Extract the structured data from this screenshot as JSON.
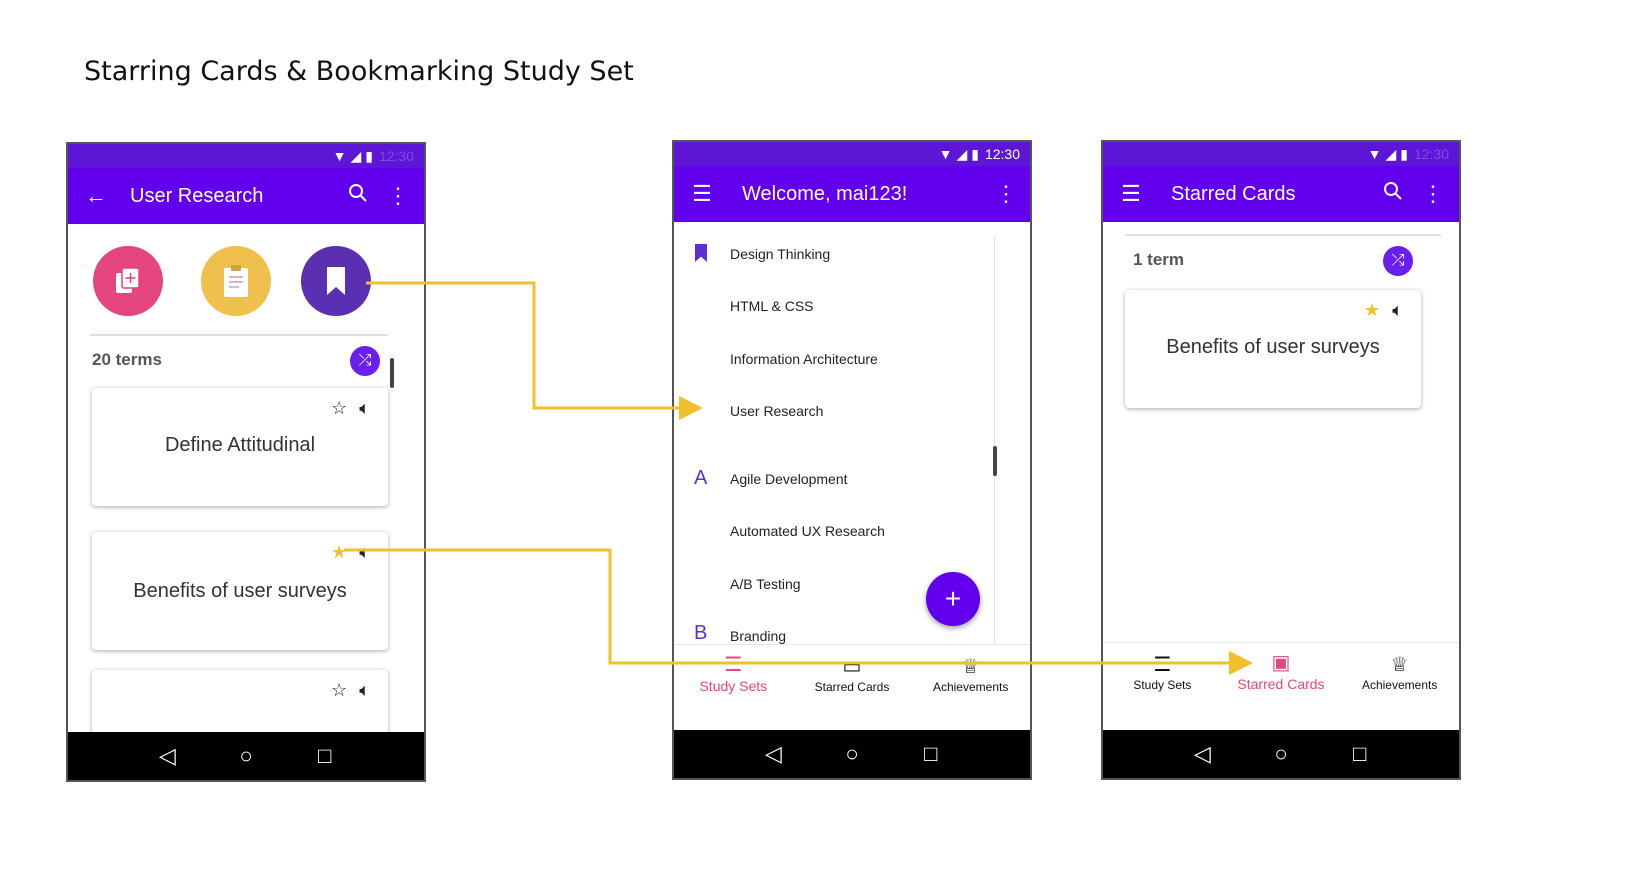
{
  "title": "Starring Cards & Bookmarking Study Set",
  "phone1": {
    "status_time": "12:30",
    "appbar_title": "User Research",
    "terms_count": "20 terms",
    "cards": [
      {
        "text": "Define Attitudinal",
        "starred": false
      },
      {
        "text": "Benefits of user surveys",
        "starred": true
      },
      {
        "text": "",
        "starred": false
      }
    ],
    "colors": {
      "add": "#e5457f",
      "quiz": "#f0c04e",
      "bookmark": "#5b2fb1"
    }
  },
  "phone2": {
    "status_time": "12:30",
    "appbar_title": "Welcome, mai123!",
    "list": [
      {
        "label": "Design Thinking",
        "marker": "bookmark"
      },
      {
        "label": "HTML & CSS",
        "marker": ""
      },
      {
        "label": "Information Architecture",
        "marker": ""
      },
      {
        "label": "User Research",
        "marker": ""
      },
      {
        "label": "Agile Development",
        "marker": "A"
      },
      {
        "label": "Automated UX Research",
        "marker": ""
      },
      {
        "label": "A/B Testing",
        "marker": ""
      },
      {
        "label": "Branding",
        "marker": "B"
      }
    ],
    "fab_label": "+",
    "tabs": [
      "Study Sets",
      "Starred Cards",
      "Achievements"
    ],
    "active_tab": "Study Sets"
  },
  "phone3": {
    "status_time": "12:30",
    "appbar_title": "Starred Cards",
    "terms_count": "1 term",
    "card_text": "Benefits of user surveys",
    "tabs": [
      "Study Sets",
      "Starred Cards",
      "Achievements"
    ],
    "active_tab": "Starred Cards"
  },
  "accent_colors": {
    "app_bar": "#6200ee",
    "active_tab": "#e8457f",
    "connector": "#f0bf2a"
  }
}
